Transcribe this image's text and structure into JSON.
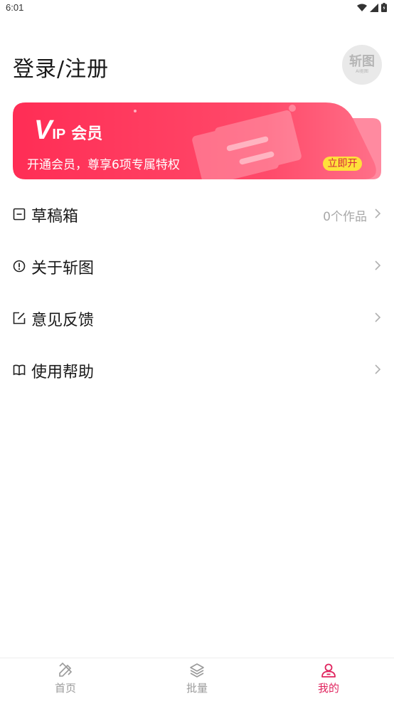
{
  "status_bar": {
    "time": "6:01"
  },
  "header": {
    "login_label": "登录/注册",
    "avatar_logo": "斩图",
    "avatar_sub": "AI抠图"
  },
  "vip": {
    "logo_v": "V",
    "logo_ip": "IP",
    "logo_member": "会员",
    "description": "开通会员，尊享6项专属特权",
    "open_button": "立即开",
    "colors": {
      "gradient_start": "#ff2d55",
      "gradient_end": "#ff8aa0",
      "button": "#ffe03a"
    }
  },
  "menu": {
    "items": [
      {
        "label": "草稿箱",
        "value": "0个作品",
        "icon": "draft-box-icon"
      },
      {
        "label": "关于斩图",
        "value": "",
        "icon": "info-icon"
      },
      {
        "label": "意见反馈",
        "value": "",
        "icon": "feedback-edit-icon"
      },
      {
        "label": "使用帮助",
        "value": "",
        "icon": "help-book-icon"
      }
    ]
  },
  "tabs": [
    {
      "label": "首页",
      "icon": "home-pencil-ruler-icon",
      "active": false
    },
    {
      "label": "批量",
      "icon": "layers-icon",
      "active": false
    },
    {
      "label": "我的",
      "icon": "profile-icon",
      "active": true
    }
  ],
  "colors": {
    "accent": "#e0245e",
    "inactive": "#9a9a9a"
  }
}
